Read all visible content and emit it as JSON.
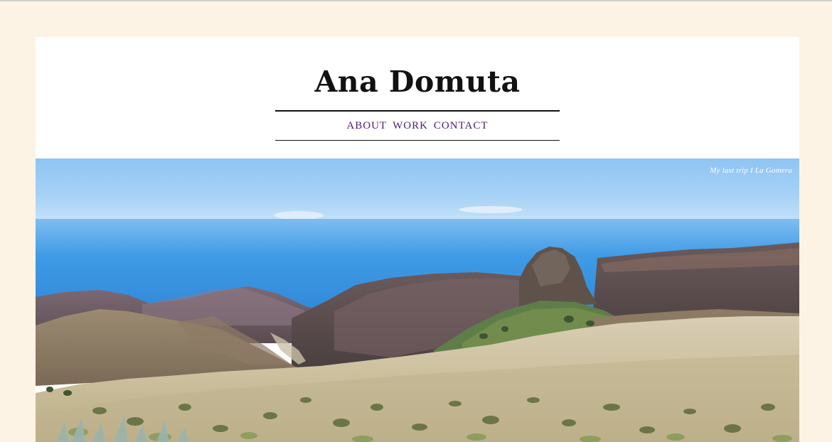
{
  "site": {
    "title": "Ana Domuta"
  },
  "nav": {
    "items": [
      {
        "label": "ABOUT"
      },
      {
        "label": "WORK"
      },
      {
        "label": "CONTACT"
      }
    ]
  },
  "hero": {
    "caption": "My last trip I La Gomera",
    "image_subject": "landscape-photo"
  },
  "colors": {
    "page_background": "#fdf3e5",
    "card_background": "#ffffff",
    "title_text": "#111111",
    "nav_link": "#4b1a7a",
    "caption_text": "#ffffff"
  }
}
